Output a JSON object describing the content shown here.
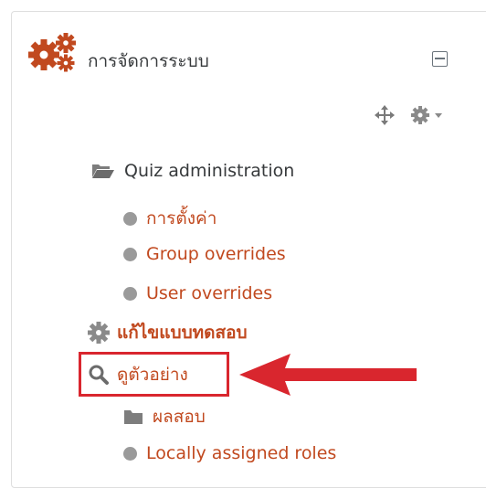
{
  "block": {
    "title": "การจัดการระบบ",
    "icons": {
      "header": "gears-icon",
      "collapse": "collapse-icon",
      "move": "move-icon",
      "actions": "cog-menu-icon"
    }
  },
  "tree": {
    "quiz_admin": {
      "label": "Quiz administration",
      "icon": "folder-open-icon"
    },
    "settings": {
      "label": "การตั้งค่า"
    },
    "group_overrides": {
      "label": "Group overrides"
    },
    "user_overrides": {
      "label": "User overrides"
    },
    "edit_quiz": {
      "label": "แก้ไขแบบทดสอบ",
      "icon": "gear-icon"
    },
    "preview": {
      "label": "ดูตัวอย่าง",
      "icon": "search-icon"
    },
    "results": {
      "label": "ผลสอบ",
      "icon": "folder-icon"
    },
    "local_roles": {
      "label": "Locally assigned roles"
    }
  },
  "annotation": {
    "color": "#d9262e",
    "arrow": "arrow-left"
  }
}
